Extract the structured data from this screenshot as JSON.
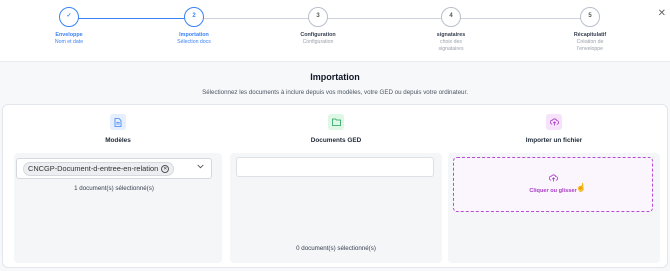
{
  "stepper": {
    "close_icon": "close-icon",
    "steps": [
      {
        "number": "✓",
        "title": "Enveloppe",
        "sub": "Nom et date",
        "state": "done"
      },
      {
        "number": "2",
        "title": "Importation",
        "sub": "Sélection docs",
        "state": "active"
      },
      {
        "number": "3",
        "title": "Configuration",
        "sub": "Configuration",
        "state": "todo"
      },
      {
        "number": "4",
        "title": "signataires",
        "sub": "choix des signataires",
        "state": "todo"
      },
      {
        "number": "5",
        "title": "Récapitulatif",
        "sub": "Création de l'enveloppe",
        "state": "todo"
      }
    ]
  },
  "header": {
    "title": "Importation",
    "description": "Sélectionnez les documents à inclure depuis vos modèles, votre GED ou depuis votre ordinateur."
  },
  "columns": {
    "models": {
      "title": "Modèles",
      "icon": "document-icon",
      "selected_chip": "CNCGP-Document-d-entree-en-relation",
      "count_text": "1 document(s) sélectionné(s)"
    },
    "ged": {
      "title": "Documents GED",
      "icon": "folder-icon",
      "input_value": "",
      "count_text": "0 document(s) sélectionné(s)"
    },
    "upload": {
      "title": "Importer un fichier",
      "icon": "upload-icon",
      "dropzone_label": "Cliquer ou glisser"
    }
  },
  "colors": {
    "accent": "#3b82f6",
    "models_icon_bg": "#e6efff",
    "ged_icon_bg": "#def7e6",
    "upload_icon_bg": "#f6e3fb",
    "upload_accent": "#a73ac6"
  }
}
